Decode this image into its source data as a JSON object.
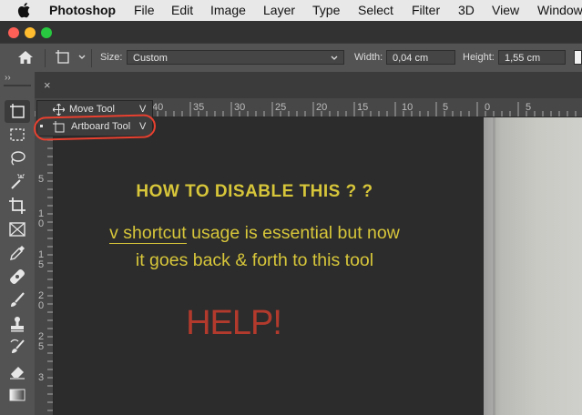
{
  "menubar": {
    "apple_icon": "apple-logo",
    "app_name": "Photoshop",
    "items": [
      "File",
      "Edit",
      "Image",
      "Layer",
      "Type",
      "Select",
      "Filter",
      "3D",
      "View",
      "Window"
    ]
  },
  "window": {
    "traffic_light_colors": [
      "#fe5f57",
      "#febc2e",
      "#28c840"
    ]
  },
  "options_bar": {
    "home_icon": "home-icon",
    "tool_preset_icon": "artboard-tool-icon",
    "size_label": "Size:",
    "size_value": "Custom",
    "width_label": "Width:",
    "width_value": "0,04 cm",
    "height_label": "Height:",
    "height_value": "1,55 cm"
  },
  "doc_tab": {
    "close_icon": "close-icon",
    "close_glyph": "×"
  },
  "toolbar": {
    "collapse_glyph": "››",
    "tools": [
      "artboard-tool-icon",
      "marquee-tool-icon",
      "lasso-tool-icon",
      "magic-wand-tool-icon",
      "crop-tool-icon",
      "frame-tool-icon",
      "eyedropper-tool-icon",
      "healing-brush-tool-icon",
      "brush-tool-icon",
      "clone-stamp-tool-icon",
      "history-brush-tool-icon",
      "eraser-tool-icon",
      "gradient-tool-icon"
    ]
  },
  "ruler_h": {
    "labels": [
      "40",
      "35",
      "30",
      "25",
      "20",
      "15",
      "10",
      "5",
      "0",
      "5"
    ]
  },
  "ruler_v": {
    "labels": [
      "5",
      "1 0",
      "1 5",
      "2 0",
      "2 5",
      "3"
    ]
  },
  "flyout": {
    "items": [
      {
        "icon": "move-tool-icon",
        "label": "Move Tool",
        "shortcut": "V",
        "active": false
      },
      {
        "icon": "artboard-tool-icon",
        "label": "Artboard Tool",
        "shortcut": "V",
        "active": true
      }
    ],
    "highlight_color": "#e8402f"
  },
  "canvas_text": {
    "title": "HOW TO DISABLE THIS ? ?",
    "line1_underlined": "v shortcut",
    "line1_rest": " usage is essential but now",
    "line2": "it goes back & forth to this tool",
    "help": "HELP!",
    "text_color": "#d7c63a",
    "help_color": "#b23a2d"
  }
}
